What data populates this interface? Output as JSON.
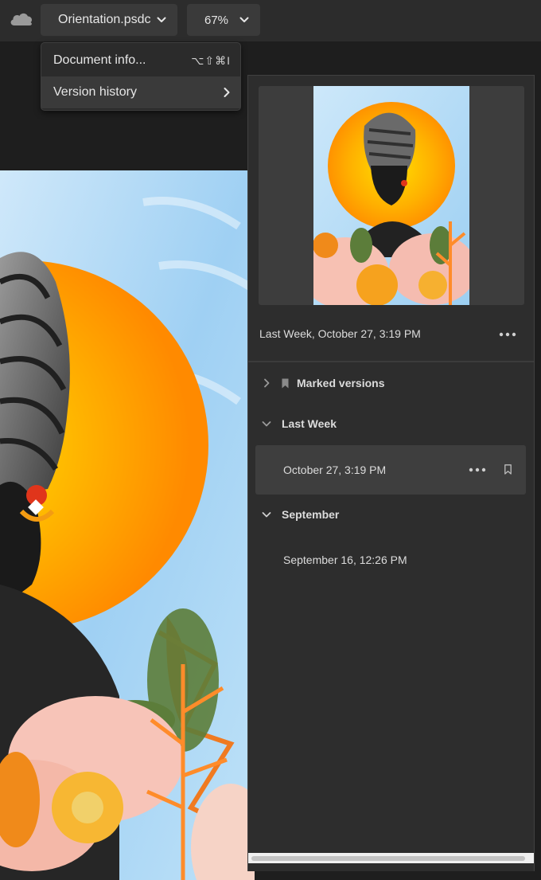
{
  "toolbar": {
    "cloud_icon": "cloud-icon",
    "document_name": "Orientation.psdc",
    "zoom": "67%"
  },
  "menu": {
    "items": [
      {
        "label": "Document info...",
        "shortcut": "⌥⇧⌘I"
      },
      {
        "label": "Version history",
        "submenu": true
      }
    ]
  },
  "version_panel": {
    "current_version_label": "Last Week, October 27, 3:19 PM",
    "sections": [
      {
        "label": "Marked versions",
        "expanded": false
      },
      {
        "label": "Last Week",
        "expanded": true
      },
      {
        "label": "September",
        "expanded": true
      }
    ],
    "versions": [
      {
        "label": "October 27, 3:19 PM",
        "selected": true
      },
      {
        "label": "September 16, 12:26 PM",
        "selected": false
      }
    ]
  },
  "colors": {
    "toolbar_bg": "#2c2c2c",
    "panel_bg": "#2d2d2d",
    "selected_row_bg": "#3e3e3e",
    "accent_orange": "#ff8c1a",
    "sky_blue": "#a9d4f2"
  }
}
